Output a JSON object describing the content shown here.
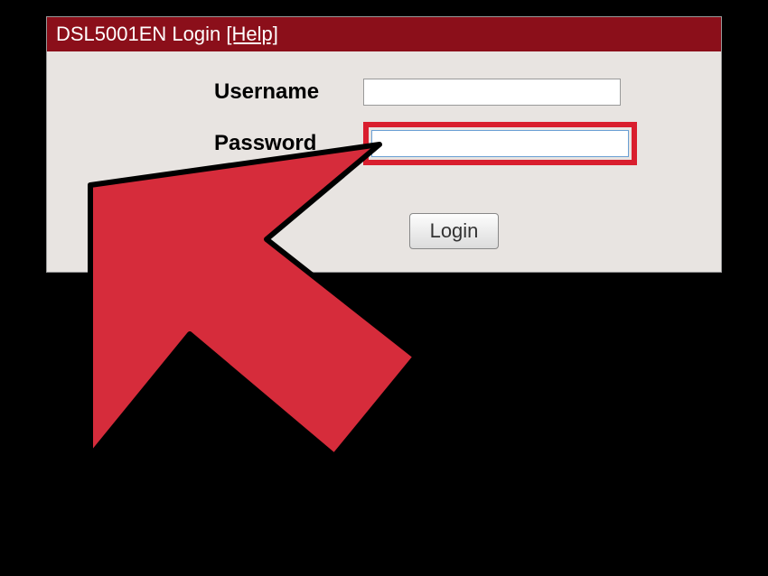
{
  "header": {
    "title": "DSL5001EN Login ",
    "help_label": "[Help]"
  },
  "form": {
    "username_label": "Username",
    "password_label": "Password",
    "username_value": "",
    "password_value": "",
    "login_button": "Login"
  },
  "colors": {
    "header_bg": "#8b0f1a",
    "highlight": "#d91e2e",
    "panel_bg": "#e8e4e1"
  }
}
